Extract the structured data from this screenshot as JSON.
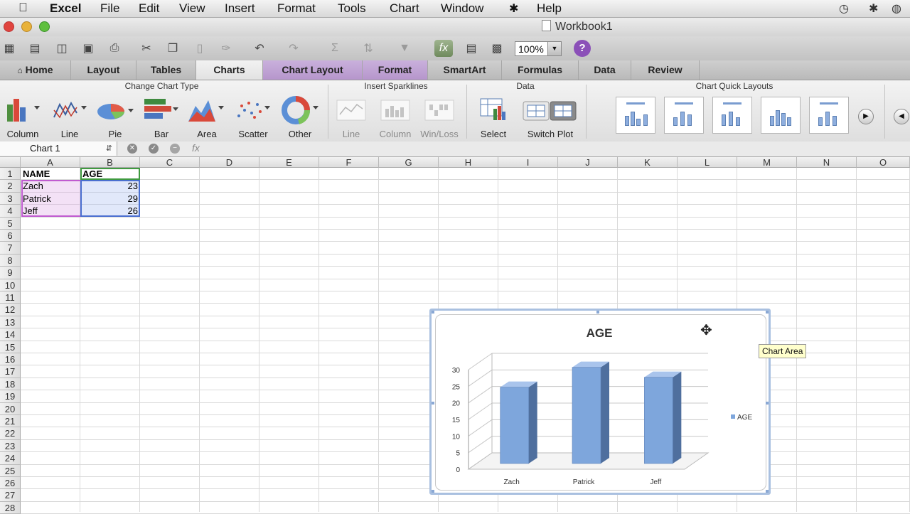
{
  "menubar": {
    "app": "Excel",
    "items": [
      "File",
      "Edit",
      "View",
      "Insert",
      "Format",
      "Tools",
      "Chart",
      "Window",
      "Help"
    ]
  },
  "window": {
    "title": "Workbook1"
  },
  "toolbar": {
    "zoom": "100%",
    "help_label": "?"
  },
  "ribbon_tabs": [
    "Home",
    "Layout",
    "Tables",
    "Charts",
    "Chart Layout",
    "Format",
    "SmartArt",
    "Formulas",
    "Data",
    "Review"
  ],
  "ribbon": {
    "groups": {
      "change_chart_type": "Change Chart Type",
      "insert_sparklines": "Insert Sparklines",
      "data": "Data",
      "chart_quick_layouts": "Chart Quick Layouts"
    },
    "chart_types": [
      "Column",
      "Line",
      "Pie",
      "Bar",
      "Area",
      "Scatter",
      "Other"
    ],
    "sparklines": [
      "Line",
      "Column",
      "Win/Loss"
    ],
    "data_buttons": [
      "Select",
      "Switch Plot"
    ]
  },
  "formula_bar": {
    "name_box": "Chart 1",
    "fx": "fx",
    "cancel_symbol": "✕",
    "accept_symbol": "✓"
  },
  "sheet": {
    "columns": [
      "A",
      "B",
      "C",
      "D",
      "E",
      "F",
      "G",
      "H",
      "I",
      "J",
      "K",
      "L",
      "M",
      "N",
      "O"
    ],
    "rows": [
      "1",
      "2",
      "3",
      "4",
      "5",
      "6",
      "7",
      "8",
      "9",
      "10",
      "11",
      "12",
      "13",
      "14",
      "15",
      "16",
      "17",
      "18",
      "19",
      "20",
      "21",
      "22",
      "23",
      "24",
      "25",
      "26",
      "27",
      "28"
    ],
    "cells": {
      "A1": "NAME",
      "B1": "AGE",
      "A2": "Zach",
      "B2": "23",
      "A3": "Patrick",
      "B3": "29",
      "A4": "Jeff",
      "B4": "26"
    }
  },
  "tooltip": "Chart Area",
  "colors": {
    "bar_fill": "#7ea6dc",
    "bar_dark": "#4f6f9e",
    "chart_border": "#a9c0e0",
    "purple_tab": "#b696cc"
  },
  "chart_data": {
    "type": "bar",
    "title": "AGE",
    "categories": [
      "Zach",
      "Patrick",
      "Jeff"
    ],
    "series": [
      {
        "name": "AGE",
        "values": [
          23,
          29,
          26
        ]
      }
    ],
    "ylim": [
      0,
      30
    ],
    "yticks": [
      "0",
      "5",
      "10",
      "15",
      "20",
      "25",
      "30"
    ],
    "grid": true,
    "legend": "right",
    "style": "3d-column"
  }
}
